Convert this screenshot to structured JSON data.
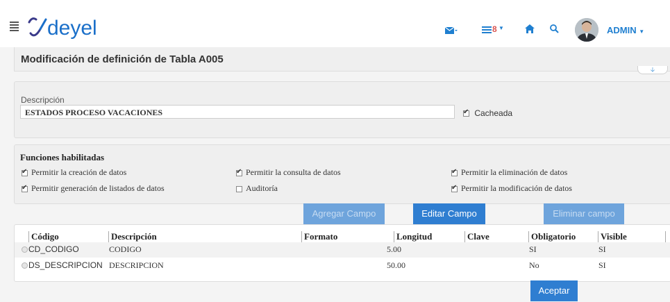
{
  "header": {
    "logo_text": "deyel",
    "notif_count": "8",
    "user": "ADMIN"
  },
  "page": {
    "title": "Modificación de definición de Tabla A005"
  },
  "description": {
    "label": "Descripción",
    "value": "ESTADOS PROCESO VACACIONES",
    "cacheada_label": "Cacheada"
  },
  "functions": {
    "title": "Funciones habilitadas",
    "items": [
      {
        "label": "Permitir la creación de datos",
        "checked": true
      },
      {
        "label": "Permitir la consulta de datos",
        "checked": true
      },
      {
        "label": "Permitir la eliminación de datos",
        "checked": true
      },
      {
        "label": "Permitir generación de listados de datos",
        "checked": true
      },
      {
        "label": "Auditoría",
        "checked": false
      },
      {
        "label": "Permitir la modificación de datos",
        "checked": true
      }
    ]
  },
  "actions": {
    "add": "Agregar Campo",
    "edit": "Editar Campo",
    "delete": "Eliminar campo",
    "accept": "Aceptar"
  },
  "table": {
    "columns": [
      "Código",
      "Descripción",
      "Formato",
      "Longitud",
      "Clave",
      "Obligatorio",
      "Visible"
    ],
    "rows": [
      {
        "codigo": "CD_CODIGO",
        "descripcion": "CODIGO",
        "formato": "",
        "longitud": "5.00",
        "clave": "",
        "obligatorio": "SI",
        "visible": "SI"
      },
      {
        "codigo": "DS_DESCRIPCION",
        "descripcion": "DESCRIPCION",
        "formato": "",
        "longitud": "50.00",
        "clave": "",
        "obligatorio": "No",
        "visible": "SI"
      }
    ]
  },
  "colors": {
    "accent": "#2f7ed1",
    "logo": "#1a6fc9",
    "logo_mark": "#3a3a8a"
  }
}
